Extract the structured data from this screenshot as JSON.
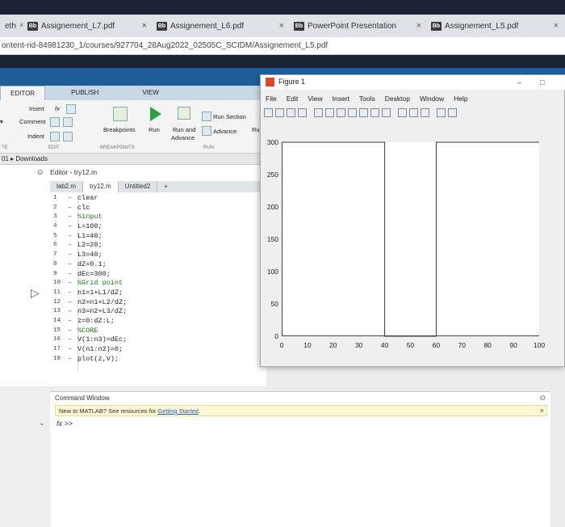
{
  "browser": {
    "tabs": [
      {
        "label": "Assignement_L7.pdf",
        "favicon": "Bb"
      },
      {
        "label": "Assignement_L6.pdf",
        "favicon": "Bb"
      },
      {
        "label": "PowerPoint Presentation",
        "favicon": "Bb"
      },
      {
        "label": "Assignement_L5.pdf",
        "favicon": "Bb"
      }
    ],
    "partial_tab": "eth",
    "url": "ontent-rid-84981230_1/courses/927704_28Aug2022_02505C_SCIDM/Assignement_L5.pdf",
    "close_glyph": "×"
  },
  "matlab": {
    "ribbon_tabs": [
      "EDITOR",
      "PUBLISH",
      "VIEW"
    ],
    "ribbon": {
      "insert": "Insert",
      "comment": "Comment",
      "indent": "Indent",
      "fx": "fx",
      "breakpoints": "Breakpoints",
      "run": "Run",
      "run_and_advance_1": "Run and",
      "run_and_advance_2": "Advance",
      "run_section": "Run Section",
      "advance": "Advance",
      "ru": "Ru",
      "edit_group": "EDIT",
      "breakpoints_group": "BREAKPOINTS",
      "run_group": "RUN",
      "te_group": "TE"
    },
    "path": "01 ▸ Downloads",
    "editor": {
      "title": "Editor - try12.m",
      "tabs": [
        "lab2.m",
        "try12.m",
        "Untitled2"
      ],
      "lines": [
        {
          "n": "1",
          "t": "clear",
          "c": false
        },
        {
          "n": "2",
          "t": "clc",
          "c": false
        },
        {
          "n": "3",
          "t": "%input",
          "c": true
        },
        {
          "n": "4",
          "t": "L=100;",
          "c": false
        },
        {
          "n": "5",
          "t": "L1=40;",
          "c": false
        },
        {
          "n": "6",
          "t": "L2=20;",
          "c": false
        },
        {
          "n": "7",
          "t": "L3=40;",
          "c": false
        },
        {
          "n": "8",
          "t": "dZ=0.1;",
          "c": false
        },
        {
          "n": "9",
          "t": "dEc=300;",
          "c": false
        },
        {
          "n": "10",
          "t": "%Grid point",
          "c": true
        },
        {
          "n": "11",
          "t": "n1=1+L1/dZ;",
          "c": false
        },
        {
          "n": "12",
          "t": "n2=n1+L2/dZ;",
          "c": false
        },
        {
          "n": "13",
          "t": "n3=n2+L3/dZ;",
          "c": false
        },
        {
          "n": "14",
          "t": "z=0:dZ:L;",
          "c": false
        },
        {
          "n": "15",
          "t": "%CORE",
          "c": true
        },
        {
          "n": "16",
          "t": "V(1:n3)=dEc;",
          "c": false
        },
        {
          "n": "17",
          "t": "V(n1:n2)=0;",
          "c": false
        },
        {
          "n": "18",
          "t": "plot(z,V);",
          "c": false
        }
      ]
    },
    "command_window": {
      "title": "Command Window",
      "note": "New to MATLAB? See resources for ",
      "note_link": "Getting Started",
      "note_end": ".",
      "prompt": "fx >>"
    }
  },
  "figure": {
    "title": "Figure 1",
    "menu": [
      "File",
      "Edit",
      "View",
      "Insert",
      "Tools",
      "Desktop",
      "Window",
      "Help"
    ],
    "minimize": "–",
    "maximize": "□"
  },
  "chart_data": {
    "type": "line",
    "xlim": [
      0,
      100
    ],
    "ylim": [
      0,
      300
    ],
    "xticks": [
      "0",
      "10",
      "20",
      "30",
      "40",
      "50",
      "60",
      "70",
      "80",
      "90",
      "100"
    ],
    "yticks": [
      "0",
      "50",
      "100",
      "150",
      "200",
      "250",
      "300"
    ],
    "series": [
      {
        "x": [
          0,
          0,
          40,
          40,
          60,
          60,
          100,
          100
        ],
        "y": [
          300,
          300,
          300,
          0,
          0,
          300,
          300,
          300
        ],
        "color": "#0072bd"
      }
    ]
  }
}
